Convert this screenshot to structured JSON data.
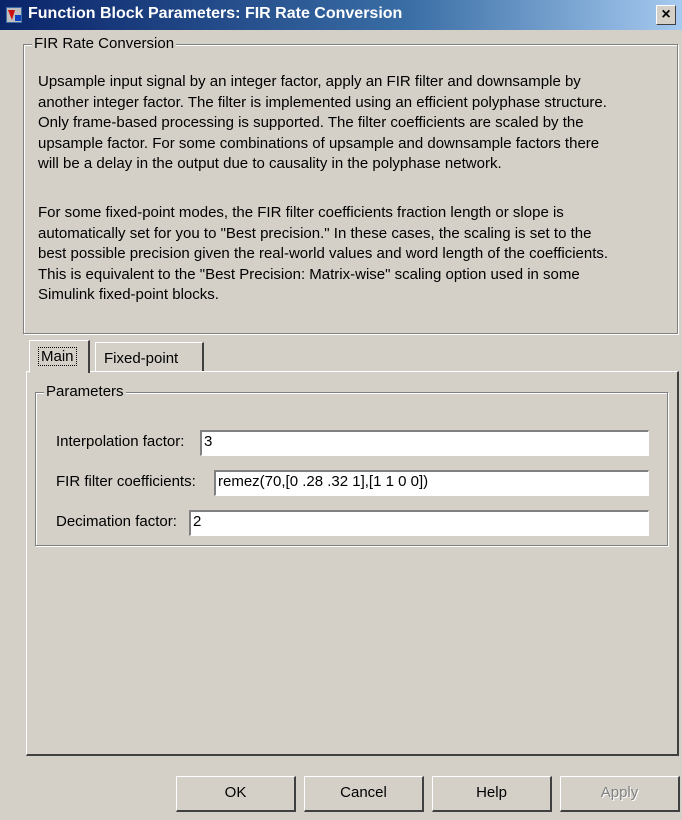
{
  "window": {
    "title": "Function Block Parameters: FIR Rate Conversion",
    "icon": "simulink-block-icon",
    "close_glyph": "×"
  },
  "description": {
    "group_title": "FIR Rate Conversion",
    "paragraph1": "Upsample input signal by an integer factor, apply an FIR filter and downsample by\nanother integer factor. The filter is implemented using an efficient polyphase structure.\nOnly frame-based processing is supported.  The filter coefficients are scaled by the\nupsample factor. For some combinations of upsample and downsample factors there\nwill be a delay in the output due to causality in the polyphase network.",
    "paragraph2": "For some fixed-point modes, the FIR filter coefficients fraction length or slope is\nautomatically set for you to \"Best precision.\" In these cases, the scaling is set to the\nbest possible precision given the real-world values and word length of the coefficients.\nThis is equivalent to the \"Best Precision: Matrix-wise\" scaling option used in some\nSimulink fixed-point blocks."
  },
  "tabs": [
    {
      "label": "Main",
      "active": true
    },
    {
      "label": "Fixed-point",
      "active": false
    }
  ],
  "parameters": {
    "group_title": "Parameters",
    "interpolation_label": "Interpolation factor:",
    "interpolation_value": "3",
    "coefficients_label": "FIR filter coefficients:",
    "coefficients_value": "remez(70,[0 .28 .32 1],[1 1 0 0])",
    "decimation_label": "Decimation factor:",
    "decimation_value": "2"
  },
  "buttons": {
    "ok": "OK",
    "cancel": "Cancel",
    "help": "Help",
    "apply": "Apply",
    "apply_enabled": false
  }
}
